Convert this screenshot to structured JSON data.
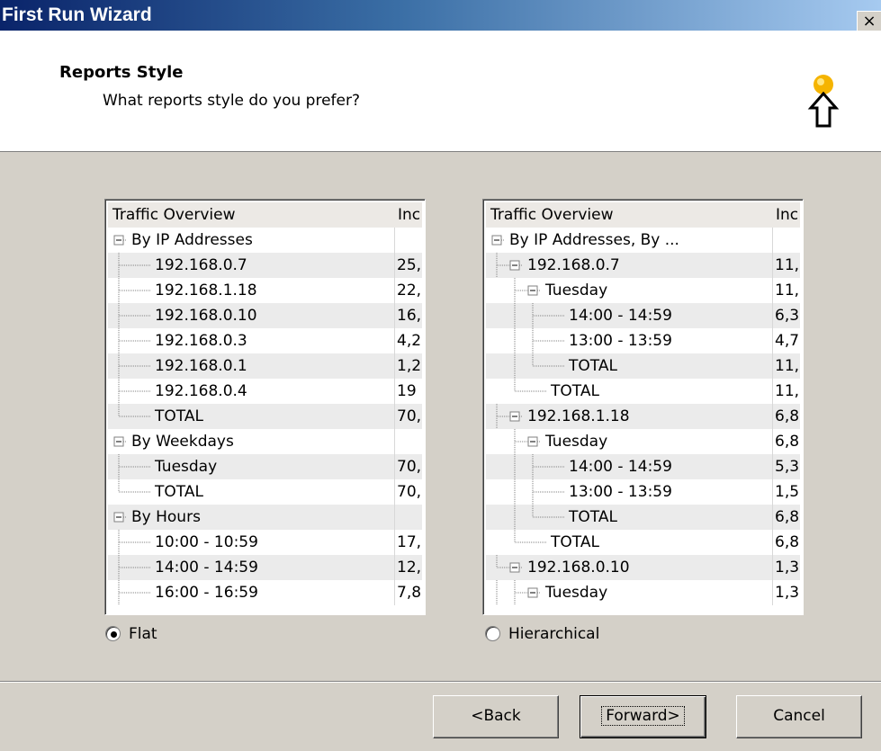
{
  "window": {
    "title": "First Run Wizard",
    "close_glyph": "×"
  },
  "header": {
    "title": "Reports Style",
    "subtitle": "What reports style do you prefer?",
    "icon": "lightbulb-arrow-icon",
    "icon_color": "#f5b400"
  },
  "flat_preview": {
    "columns": [
      "Traffic Overview",
      "Inc"
    ],
    "rows": [
      {
        "label": "By IP Addresses",
        "value": "",
        "level": 0,
        "expander": true
      },
      {
        "label": "192.168.0.7",
        "value": "25,",
        "level": 1
      },
      {
        "label": "192.168.1.18",
        "value": "22,",
        "level": 1
      },
      {
        "label": "192.168.0.10",
        "value": "16,",
        "level": 1
      },
      {
        "label": "192.168.0.3",
        "value": "4,2",
        "level": 1
      },
      {
        "label": "192.168.0.1",
        "value": "1,2",
        "level": 1
      },
      {
        "label": "192.168.0.4",
        "value": "19",
        "level": 1
      },
      {
        "label": "TOTAL",
        "value": "70,",
        "level": 1
      },
      {
        "label": "By Weekdays",
        "value": "",
        "level": 0,
        "expander": true
      },
      {
        "label": "Tuesday",
        "value": "70,",
        "level": 1
      },
      {
        "label": "TOTAL",
        "value": "70,",
        "level": 1
      },
      {
        "label": "By Hours",
        "value": "",
        "level": 0,
        "expander": true
      },
      {
        "label": "10:00 - 10:59",
        "value": "17,",
        "level": 1
      },
      {
        "label": "14:00 - 14:59",
        "value": "12,",
        "level": 1
      },
      {
        "label": "16:00 - 16:59",
        "value": "7,8",
        "level": 1
      }
    ]
  },
  "hier_preview": {
    "columns": [
      "Traffic Overview",
      "Inc"
    ],
    "rows": [
      {
        "label": "By IP Addresses, By ...",
        "value": "",
        "level": 0,
        "expander": true
      },
      {
        "label": "192.168.0.7",
        "value": "11,",
        "level": 1,
        "expander": true
      },
      {
        "label": "Tuesday",
        "value": "11,",
        "level": 2,
        "expander": true
      },
      {
        "label": "14:00 - 14:59",
        "value": "6,3",
        "level": 3
      },
      {
        "label": "13:00 - 13:59",
        "value": "4,7",
        "level": 3
      },
      {
        "label": "TOTAL",
        "value": "11,",
        "level": 3
      },
      {
        "label": "TOTAL",
        "value": "11,",
        "level": 2
      },
      {
        "label": "192.168.1.18",
        "value": "6,8",
        "level": 1,
        "expander": true
      },
      {
        "label": "Tuesday",
        "value": "6,8",
        "level": 2,
        "expander": true
      },
      {
        "label": "14:00 - 14:59",
        "value": "5,3",
        "level": 3
      },
      {
        "label": "13:00 - 13:59",
        "value": "1,5",
        "level": 3
      },
      {
        "label": "TOTAL",
        "value": "6,8",
        "level": 3
      },
      {
        "label": "TOTAL",
        "value": "6,8",
        "level": 2
      },
      {
        "label": "192.168.0.10",
        "value": "1,3",
        "level": 1,
        "expander": true
      },
      {
        "label": "Tuesday",
        "value": "1,3",
        "level": 2,
        "expander": true
      }
    ]
  },
  "style_options": {
    "flat_label": "Flat",
    "hierarchical_label": "Hierarchical",
    "selected": "flat"
  },
  "buttons": {
    "back": "<Back",
    "forward": "Forward>",
    "cancel": "Cancel"
  }
}
